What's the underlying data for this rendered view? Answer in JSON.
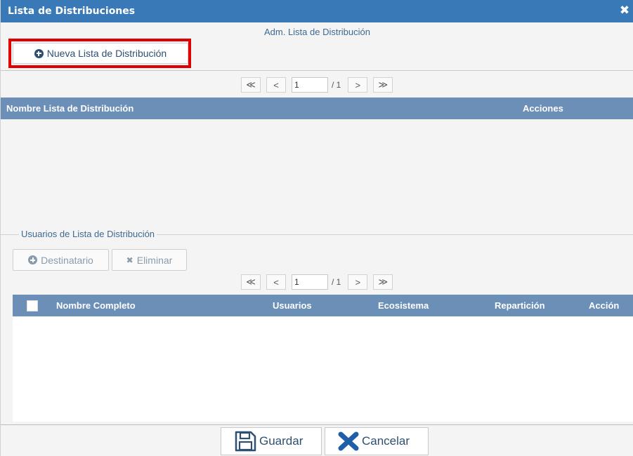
{
  "dialog": {
    "title": "Lista de Distribuciones",
    "close_icon": "close-icon",
    "subtitle": "Adm. Lista de Distribución"
  },
  "new_list_button": {
    "label": "Nueva Lista de Distribución",
    "icon": "plus-circle-icon"
  },
  "list_pager": {
    "first": "≪",
    "prev": "<",
    "page_value": "1",
    "total": "/ 1",
    "next": ">",
    "last": "≫"
  },
  "list_table": {
    "columns": [
      "Nombre Lista de Distribución",
      "Acciones"
    ],
    "rows": []
  },
  "users_section": {
    "legend": "Usuarios de Lista de Distribución",
    "add_button": {
      "label": "Destinatario",
      "icon": "plus-circle-icon"
    },
    "delete_button": {
      "label": "Eliminar",
      "icon": "x-icon"
    }
  },
  "users_pager": {
    "first": "≪",
    "prev": "<",
    "page_value": "1",
    "total": "/ 1",
    "next": ">",
    "last": "≫"
  },
  "users_table": {
    "columns": [
      "Nombre Completo",
      "Usuarios",
      "Ecosistema",
      "Repartición",
      "Acción"
    ],
    "rows": []
  },
  "footer": {
    "save_label": "Guardar",
    "cancel_label": "Cancelar"
  },
  "colors": {
    "titlebar": "#3a79b8",
    "table_header": "#6c8fb7",
    "highlight_border": "#e00000",
    "cancel_icon": "#1e5fa8"
  }
}
